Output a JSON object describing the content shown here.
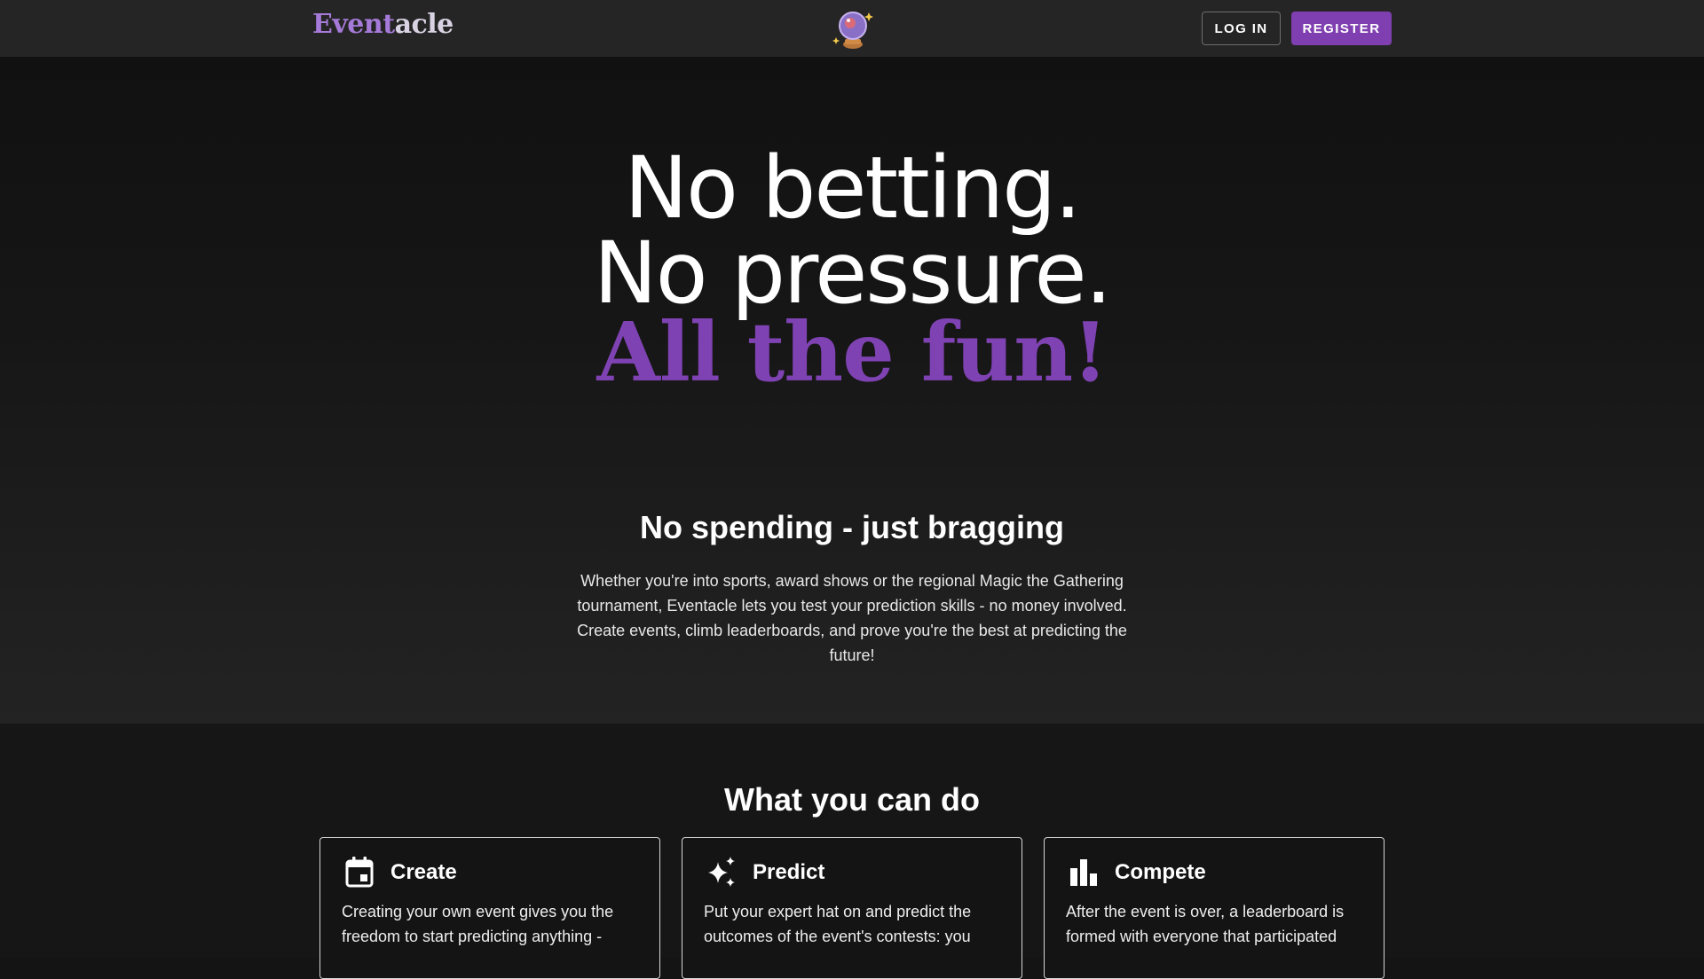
{
  "header": {
    "logo_part1": "Event",
    "logo_part2": "acle",
    "login_label": "LOG IN",
    "register_label": "REGISTER"
  },
  "hero": {
    "line1": "No betting.",
    "line2": "No pressure.",
    "line3": "All the fun!",
    "subheading": "No spending - just bragging",
    "description": "Whether you're into sports, award shows or the regional Magic the Gathering tournament, Eventacle lets you test your prediction skills - no money involved. Create events, climb leaderboards, and prove you're the best at predicting the future!"
  },
  "features": {
    "title": "What you can do",
    "cards": [
      {
        "icon": "calendar-icon",
        "title": "Create",
        "text": "Creating your own event gives you the freedom to start predicting anything -"
      },
      {
        "icon": "sparkles-icon",
        "title": "Predict",
        "text": "Put your expert hat on and predict the outcomes of the event's contests: you"
      },
      {
        "icon": "bar-chart-icon",
        "title": "Compete",
        "text": "After the event is over, a leaderboard is formed with everyone that participated"
      }
    ]
  },
  "colors": {
    "accent": "#7f42b3",
    "register_button": "#7f3fb0",
    "logo_purple": "#a57ad8",
    "header_bg": "#252525"
  }
}
